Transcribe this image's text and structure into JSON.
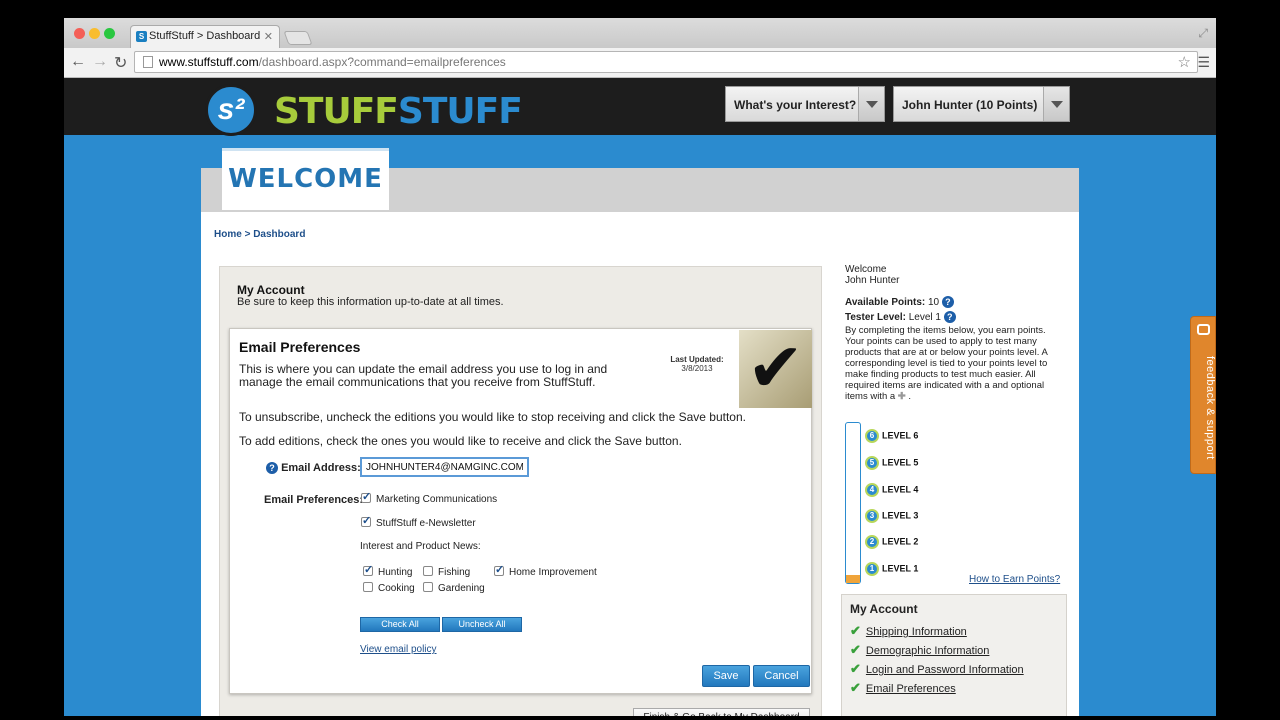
{
  "browser": {
    "tab_title": "StuffStuff > Dashboard",
    "url_domain": "www.stuffstuff.com",
    "url_path": "/dashboard.aspx?command=emailpreferences"
  },
  "header": {
    "logo_mark": "s²",
    "logo_word_a": "STUFF",
    "logo_word_b": "STUFF",
    "interest_btn": "What's your Interest?",
    "user_btn": "John Hunter  (10 Points)"
  },
  "welcome_tab": "WELCOME",
  "breadcrumb": {
    "home": "Home",
    "sep": " > ",
    "current": "Dashboard"
  },
  "account": {
    "title": "My Account",
    "subtitle": "Be sure to keep this information up-to-date at all times."
  },
  "email_prefs": {
    "title": "Email Preferences",
    "description": "This is where you can update the email address you use to log in and manage the email communications that you receive from StuffStuff.",
    "last_updated_label": "Last Updated:",
    "last_updated_value": "3/8/2013",
    "instr_unsubscribe": "To unsubscribe, uncheck the editions you would like to stop receiving and click the Save button.",
    "instr_add": "To add editions, check the ones you would like to receive and click the Save button.",
    "email_label": "Email Address:",
    "email_value": "JOHNHUNTER4@NAMGINC.COM",
    "prefs_label": "Email Preferences:",
    "marketing": "Marketing Communications",
    "newsletter": "StuffStuff e-Newsletter",
    "interest_label": "Interest and Product News:",
    "hunting": "Hunting",
    "fishing": "Fishing",
    "home_improvement": "Home Improvement",
    "cooking": "Cooking",
    "gardening": "Gardening",
    "check_all": "Check All",
    "uncheck_all": "Uncheck All",
    "view_policy": "View email policy",
    "save": "Save",
    "cancel": "Cancel",
    "finish": "Finish & Go Back to My Dashboard"
  },
  "sidebar": {
    "welcome": "Welcome",
    "name": "John Hunter",
    "points_label": "Available Points:",
    "points_value": "10",
    "tester_label": "Tester Level:",
    "tester_value": "Level 1",
    "para": "By completing the items below, you earn points. Your points can be used to apply to test many products that are at or below your points level. A corresponding level is tied to your points level to make finding products to test much easier. All required items are indicated with a and optional items with a",
    "levels": [
      "LEVEL 6",
      "LEVEL 5",
      "LEVEL 4",
      "LEVEL 3",
      "LEVEL 2",
      "LEVEL 1"
    ],
    "level_nums": [
      "6",
      "5",
      "4",
      "3",
      "2",
      "1"
    ],
    "progress_fraction": 0.05,
    "how_to_earn": "How to Earn Points?",
    "my_account_title": "My Account",
    "my_account_items": [
      "Shipping Information",
      "Demographic Information",
      "Login and Password Information",
      "Email Preferences"
    ]
  },
  "feedback": "feedback & support",
  "colors": {
    "brand_blue": "#2b8bcf",
    "brand_green": "#a7cc3b",
    "feedback_orange": "#e0862c"
  }
}
